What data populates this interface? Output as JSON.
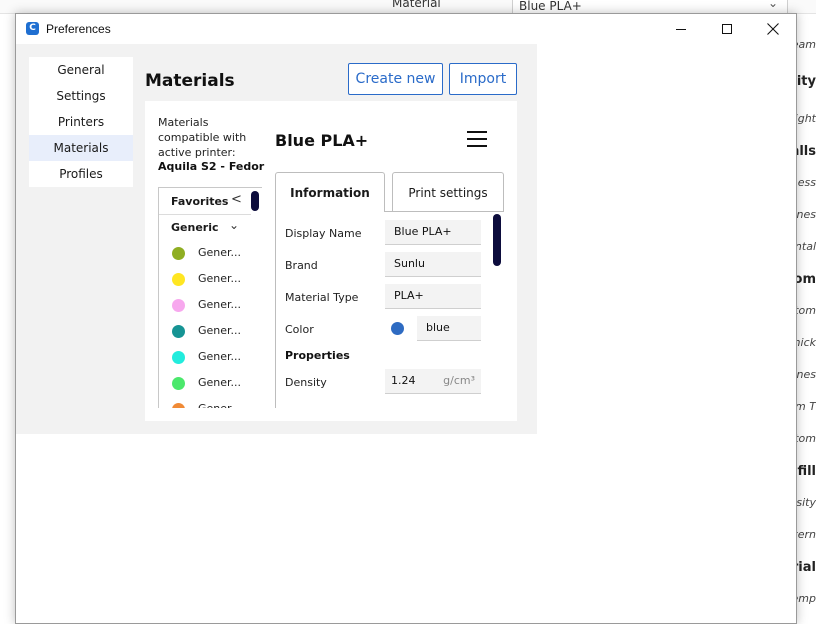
{
  "background": {
    "material_label": "Material",
    "material_value": "Blue PLA+",
    "right_panel": [
      {
        "text": "Seam",
        "kind": "item"
      },
      {
        "text": "Quality",
        "kind": "head"
      },
      {
        "text": "Height",
        "kind": "item"
      },
      {
        "text": "Walls",
        "kind": "head"
      },
      {
        "text": "Thickness",
        "kind": "item"
      },
      {
        "text": "Lines",
        "kind": "item"
      },
      {
        "text": "Horizontal",
        "kind": "item"
      },
      {
        "text": "Top/Bottom",
        "kind": "head"
      },
      {
        "text": "Bottom",
        "kind": "item"
      },
      {
        "text": "Thick",
        "kind": "item"
      },
      {
        "text": "Top Lines",
        "kind": "item"
      },
      {
        "text": "Bottom T",
        "kind": "item"
      },
      {
        "text": "Bottom",
        "kind": "item"
      },
      {
        "text": "Infill",
        "kind": "head"
      },
      {
        "text": "Density",
        "kind": "item"
      },
      {
        "text": "Pattern",
        "kind": "item"
      },
      {
        "text": "Material",
        "kind": "head"
      },
      {
        "text": "Printing Temp",
        "kind": "item"
      }
    ]
  },
  "window": {
    "title": "Preferences",
    "app_icon_letter": "C"
  },
  "sidebar": {
    "items": [
      {
        "label": "General",
        "active": false
      },
      {
        "label": "Settings",
        "active": false
      },
      {
        "label": "Printers",
        "active": false
      },
      {
        "label": "Materials",
        "active": true
      },
      {
        "label": "Profiles",
        "active": false
      }
    ]
  },
  "header": {
    "title": "Materials",
    "create_label": "Create new",
    "import_label": "Import"
  },
  "compat": {
    "text": "Materials compatible with active printer:",
    "printer": "Aquila S2 - Fedor"
  },
  "list": {
    "favorites_label": "Favorites",
    "generic_label": "Generic",
    "items": [
      {
        "name": "Gener...",
        "color": "#8fae22"
      },
      {
        "name": "Gener...",
        "color": "#ffe622"
      },
      {
        "name": "Gener...",
        "color": "#f7a8ee"
      },
      {
        "name": "Gener...",
        "color": "#169494"
      },
      {
        "name": "Gener...",
        "color": "#22ecdd"
      },
      {
        "name": "Gener...",
        "color": "#4be86c"
      },
      {
        "name": "Gener...",
        "color": "#f08a36"
      }
    ]
  },
  "material": {
    "name": "Blue PLA+",
    "tabs": {
      "info": "Information",
      "print": "Print settings"
    },
    "fields": {
      "display_name_label": "Display Name",
      "display_name": "Blue PLA+",
      "brand_label": "Brand",
      "brand": "Sunlu",
      "type_label": "Material Type",
      "type": "PLA+",
      "color_label": "Color",
      "color_name": "blue",
      "color_hex": "#2e6bc2",
      "properties_label": "Properties",
      "density_label": "Density",
      "density": "1.24",
      "density_unit": "g/cm³"
    }
  }
}
